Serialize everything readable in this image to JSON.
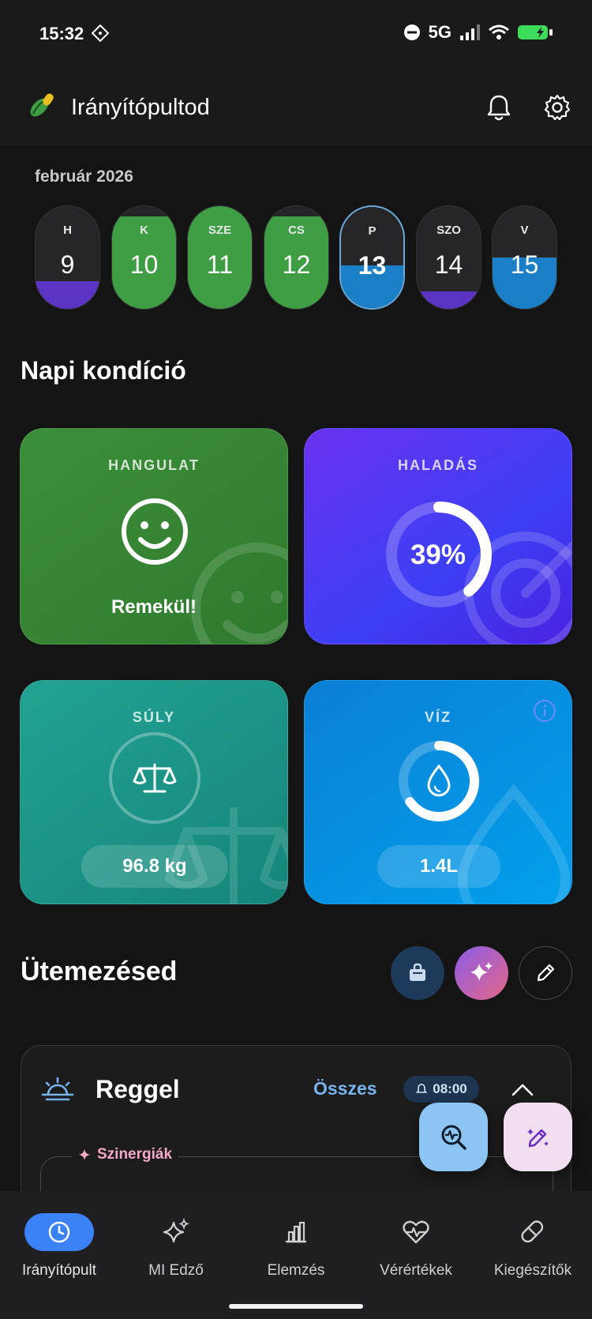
{
  "status": {
    "time": "15:32",
    "network": "5G"
  },
  "header": {
    "title": "Irányítópultod"
  },
  "calendar": {
    "month": "február 2026",
    "days": [
      {
        "label": "H",
        "num": "9",
        "fill_pct": 0.27,
        "fill_color": "#5a35c4",
        "selected": false
      },
      {
        "label": "K",
        "num": "10",
        "fill_pct": 0.9,
        "fill_color": "#3f9d44",
        "selected": false
      },
      {
        "label": "SZE",
        "num": "11",
        "fill_pct": 1.0,
        "fill_color": "#3f9d44",
        "selected": false
      },
      {
        "label": "CS",
        "num": "12",
        "fill_pct": 0.9,
        "fill_color": "#3f9d44",
        "selected": false
      },
      {
        "label": "P",
        "num": "13",
        "fill_pct": 0.42,
        "fill_color": "#1a7fc4",
        "selected": true
      },
      {
        "label": "SZO",
        "num": "14",
        "fill_pct": 0.17,
        "fill_color": "#5a35c4",
        "selected": false
      },
      {
        "label": "V",
        "num": "15",
        "fill_pct": 0.5,
        "fill_color": "#1a7fc4",
        "selected": false
      }
    ]
  },
  "condition": {
    "title": "Napi kondíció",
    "mood": {
      "title": "HANGULAT",
      "value": "Remekül!",
      "icon": "smiley-icon"
    },
    "progress": {
      "title": "HALADÁS",
      "value": "39%",
      "percent": 0.39
    },
    "weight": {
      "title": "SÚLY",
      "value": "96.8 kg",
      "icon": "scale-icon"
    },
    "water": {
      "title": "VÍZ",
      "value": "1.4L",
      "fill": 0.65,
      "icon": "water-drop-icon"
    }
  },
  "schedule": {
    "title": "Ütemezésed",
    "section": {
      "title": "Reggel",
      "all_label": "Összes",
      "time": "08:00",
      "synergy_label": "Szinergiák"
    }
  },
  "nav": {
    "items": [
      {
        "label": "Irányítópult",
        "icon": "clock-icon",
        "active": true
      },
      {
        "label": "MI Edző",
        "icon": "sparkles-icon",
        "active": false
      },
      {
        "label": "Elemzés",
        "icon": "bar-chart-icon",
        "active": false
      },
      {
        "label": "Vérértékek",
        "icon": "heart-pulse-icon",
        "active": false
      },
      {
        "label": "Kiegészítők",
        "icon": "pill-icon",
        "active": false
      }
    ]
  },
  "colors": {
    "accent": "#3b82f6",
    "mood_card": "#3a8a38",
    "progress_card": "#4b2ff0",
    "weight_card": "#1f9a8a",
    "water_card": "#0a96e4"
  }
}
